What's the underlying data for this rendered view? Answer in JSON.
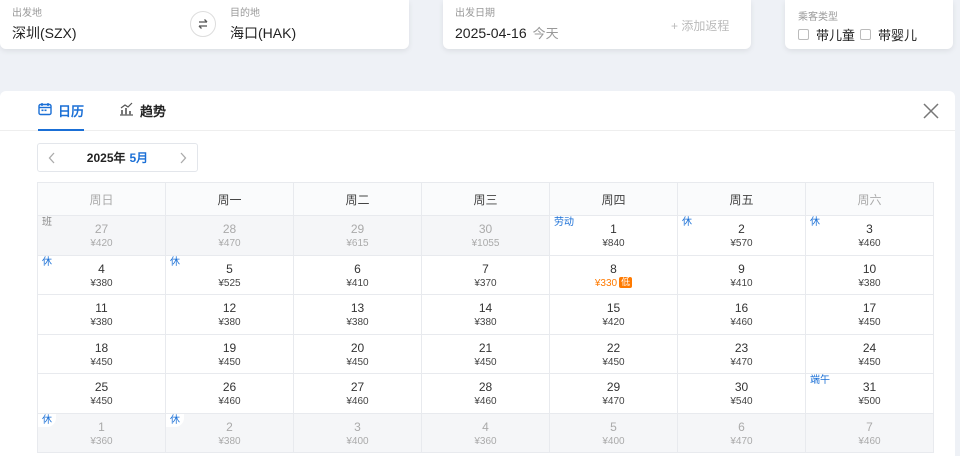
{
  "route": {
    "from_label": "出发地",
    "from_value": "深圳(SZX)",
    "to_label": "目的地",
    "to_value": "海口(HAK)"
  },
  "date": {
    "label": "出发日期",
    "value": "2025-04-16",
    "today": "今天",
    "add_return": "+ 添加返程"
  },
  "passenger": {
    "label": "乘客类型",
    "child": "带儿童",
    "infant": "带婴儿"
  },
  "tabs": {
    "calendar": "日历",
    "trend": "趋势"
  },
  "month_nav": {
    "year": "2025年",
    "month": "5月"
  },
  "weekdays": [
    "周日",
    "周一",
    "周二",
    "周三",
    "周四",
    "周五",
    "周六"
  ],
  "weeks": [
    [
      {
        "day": "27",
        "price": "¥420",
        "tag": "班",
        "tag_type": "work",
        "other": true
      },
      {
        "day": "28",
        "price": "¥470",
        "other": true
      },
      {
        "day": "29",
        "price": "¥615",
        "other": true
      },
      {
        "day": "30",
        "price": "¥1055",
        "other": true
      },
      {
        "day": "1",
        "price": "¥840",
        "tag": "劳动",
        "tag_type": "rest"
      },
      {
        "day": "2",
        "price": "¥570",
        "tag": "休",
        "tag_type": "rest"
      },
      {
        "day": "3",
        "price": "¥460",
        "tag": "休",
        "tag_type": "rest"
      }
    ],
    [
      {
        "day": "4",
        "price": "¥380",
        "tag": "休",
        "tag_type": "rest"
      },
      {
        "day": "5",
        "price": "¥525",
        "tag": "休",
        "tag_type": "rest"
      },
      {
        "day": "6",
        "price": "¥410"
      },
      {
        "day": "7",
        "price": "¥370"
      },
      {
        "day": "8",
        "price": "¥330",
        "low": true,
        "low_label": "低"
      },
      {
        "day": "9",
        "price": "¥410"
      },
      {
        "day": "10",
        "price": "¥380"
      }
    ],
    [
      {
        "day": "11",
        "price": "¥380"
      },
      {
        "day": "12",
        "price": "¥380"
      },
      {
        "day": "13",
        "price": "¥380"
      },
      {
        "day": "14",
        "price": "¥380"
      },
      {
        "day": "15",
        "price": "¥420"
      },
      {
        "day": "16",
        "price": "¥460"
      },
      {
        "day": "17",
        "price": "¥450"
      }
    ],
    [
      {
        "day": "18",
        "price": "¥450"
      },
      {
        "day": "19",
        "price": "¥450"
      },
      {
        "day": "20",
        "price": "¥450"
      },
      {
        "day": "21",
        "price": "¥450"
      },
      {
        "day": "22",
        "price": "¥450"
      },
      {
        "day": "23",
        "price": "¥470"
      },
      {
        "day": "24",
        "price": "¥450"
      }
    ],
    [
      {
        "day": "25",
        "price": "¥450"
      },
      {
        "day": "26",
        "price": "¥460"
      },
      {
        "day": "27",
        "price": "¥460"
      },
      {
        "day": "28",
        "price": "¥460"
      },
      {
        "day": "29",
        "price": "¥470"
      },
      {
        "day": "30",
        "price": "¥540"
      },
      {
        "day": "31",
        "price": "¥500",
        "tag": "端午",
        "tag_type": "rest"
      }
    ],
    [
      {
        "day": "1",
        "price": "¥360",
        "tag": "休",
        "tag_type": "rest",
        "other": true
      },
      {
        "day": "2",
        "price": "¥380",
        "tag": "休",
        "tag_type": "rest",
        "other": true
      },
      {
        "day": "3",
        "price": "¥400",
        "other": true
      },
      {
        "day": "4",
        "price": "¥360",
        "other": true
      },
      {
        "day": "5",
        "price": "¥400",
        "other": true
      },
      {
        "day": "6",
        "price": "¥470",
        "other": true
      },
      {
        "day": "7",
        "price": "¥460",
        "other": true
      }
    ]
  ],
  "colors": {
    "accent": "#1a6fd6",
    "low_price": "#ff7a00"
  },
  "icons": {
    "swap": "swap-icon",
    "calendar": "calendar-icon",
    "trend": "trend-chart-icon",
    "close": "close-icon",
    "prev": "chevron-left-icon",
    "next": "chevron-right-icon"
  }
}
